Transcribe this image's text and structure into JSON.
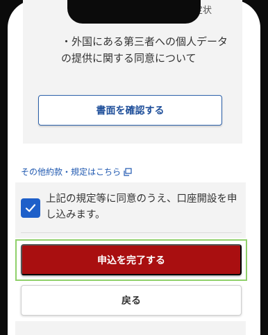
{
  "header": {
    "partial_text": "規定状"
  },
  "consent_card": {
    "document_text": "・外国にある第三者への個人データの提供に関する同意について",
    "confirm_button_label": "書面を確認する"
  },
  "other_terms": {
    "link_label": "その他約款・規定はこちら",
    "icon": "external-link-icon"
  },
  "agreement": {
    "checked": true,
    "label": "上記の規定等に同意のうえ、口座開設を申し込みます。",
    "check_icon": "checkmark-icon"
  },
  "actions": {
    "submit_label": "申込を完了する",
    "back_label": "戻る"
  },
  "colors": {
    "primary_red": "#a90f10",
    "link_blue": "#1f58b0",
    "checkbox_blue": "#1e5fc9",
    "highlight_green": "#8fd06a"
  }
}
